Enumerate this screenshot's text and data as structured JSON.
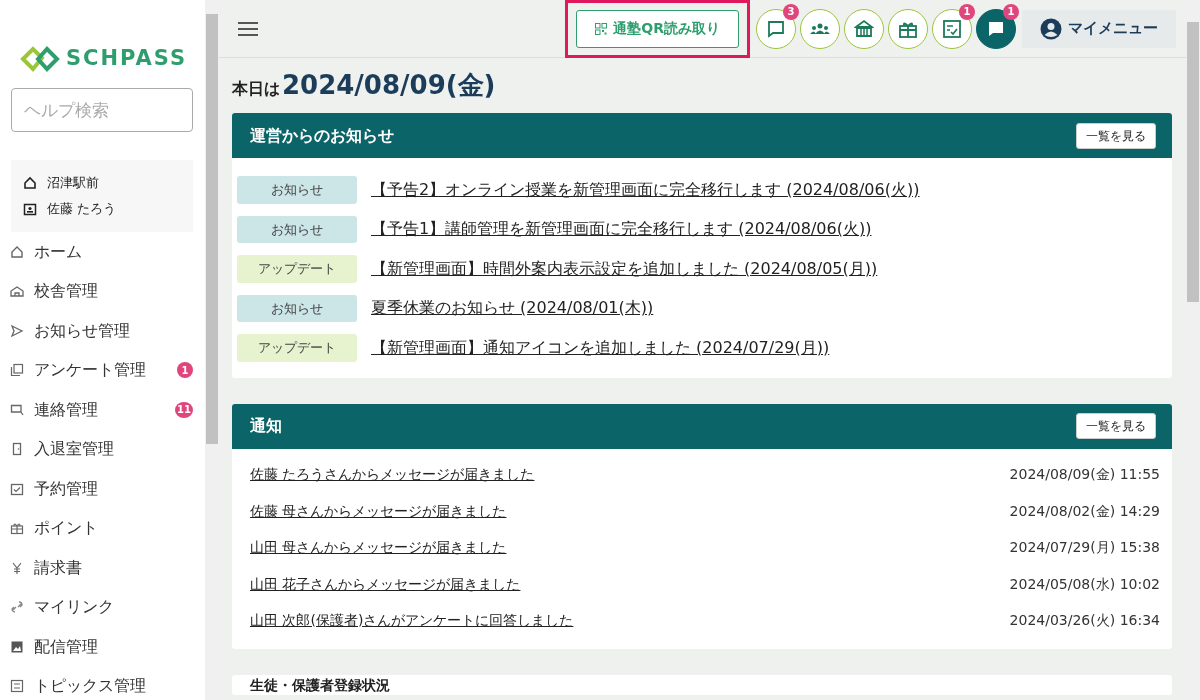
{
  "sidebar": {
    "logo": "SCHPASS",
    "search": {
      "placeholder": "ヘルプ検索"
    },
    "school": "沼津駅前",
    "user": "佐藤 たろう",
    "items": [
      {
        "label": "ホーム"
      },
      {
        "label": "校舎管理"
      },
      {
        "label": "お知らせ管理"
      },
      {
        "label": "アンケート管理",
        "badge": "1"
      },
      {
        "label": "連絡管理",
        "badge": "11"
      },
      {
        "label": "入退室管理"
      },
      {
        "label": "予約管理"
      },
      {
        "label": "ポイント"
      },
      {
        "label": "請求書"
      },
      {
        "label": "マイリンク"
      },
      {
        "label": "配信管理"
      },
      {
        "label": "トピックス管理"
      }
    ]
  },
  "header": {
    "qr_button": {
      "label": "通塾QR読み取り",
      "highlighted": true
    },
    "icon_buttons": [
      {
        "kind": "outline",
        "badge": "3"
      },
      {
        "kind": "outline"
      },
      {
        "kind": "outline"
      },
      {
        "kind": "outline"
      },
      {
        "kind": "outline",
        "badge": "1"
      },
      {
        "kind": "solid",
        "badge": "1"
      }
    ],
    "my_menu": "マイメニュー"
  },
  "today": {
    "prefix": "本日は",
    "date": "2024/08/09(金)"
  },
  "announcements": {
    "title": "運営からのお知らせ",
    "button": "一覧を見る",
    "items": [
      {
        "tag": "お知らせ",
        "kind": "notice",
        "text": "【予告2】オンライン授業を新管理画面に完全移行します (2024/08/06(火))"
      },
      {
        "tag": "お知らせ",
        "kind": "notice",
        "text": "【予告1】講師管理を新管理画面に完全移行します (2024/08/06(火))"
      },
      {
        "tag": "アップデート",
        "kind": "update",
        "text": "【新管理画面】時間外案内表示設定を追加しました (2024/08/05(月))"
      },
      {
        "tag": "お知らせ",
        "kind": "notice",
        "text": "夏季休業のお知らせ (2024/08/01(木))"
      },
      {
        "tag": "アップデート",
        "kind": "update",
        "text": "【新管理画面】通知アイコンを追加しました (2024/07/29(月))"
      }
    ]
  },
  "notifications": {
    "title": "通知",
    "button": "一覧を見る",
    "items": [
      {
        "text": "佐藤 たろうさんからメッセージが届きました",
        "time": "2024/08/09(金) 11:55"
      },
      {
        "text": "佐藤 母さんからメッセージが届きました",
        "time": "2024/08/02(金) 14:29"
      },
      {
        "text": "山田 母さんからメッセージが届きました",
        "time": "2024/07/29(月) 15:38"
      },
      {
        "text": "山田 花子さんからメッセージが届きました",
        "time": "2024/05/08(水) 10:02"
      },
      {
        "text": "山田 次郎(保護者)さんがアンケートに回答しました",
        "time": "2024/03/26(火) 16:34"
      }
    ]
  },
  "registration": {
    "title": "生徒・保護者登録状況"
  }
}
